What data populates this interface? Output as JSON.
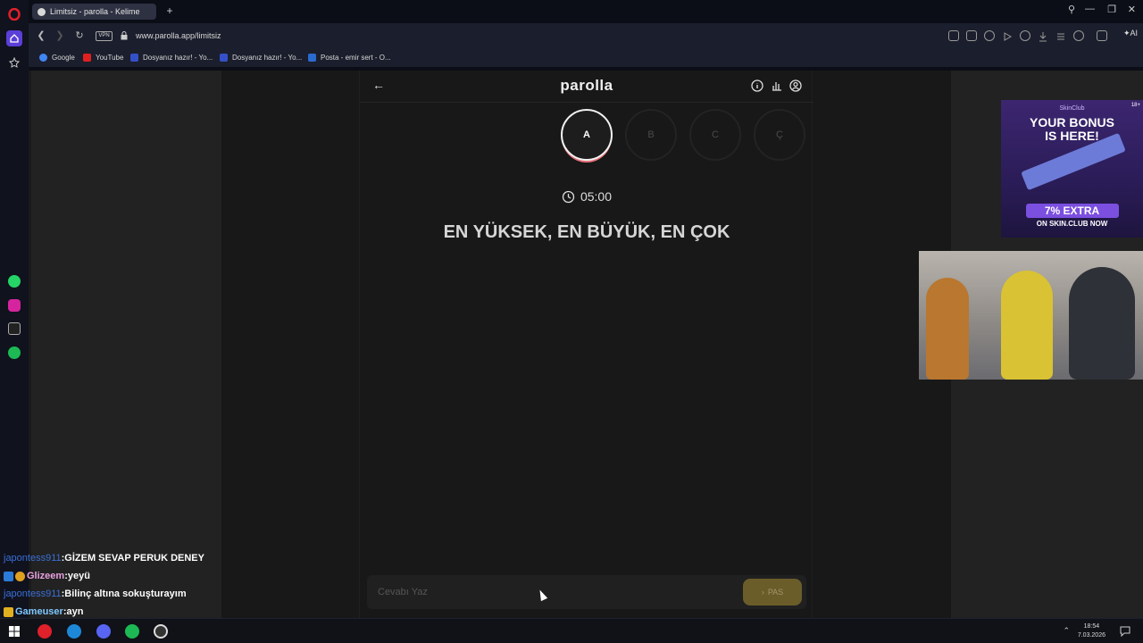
{
  "browser": {
    "tab_title": "Limitsiz - parolla - Kelime",
    "new_tab": "+",
    "vpn": "VPN",
    "url": "www.parolla.app/limitsiz",
    "ai_label": "AI"
  },
  "bookmarks": [
    {
      "label": "Google",
      "color": "#4285f4"
    },
    {
      "label": "YouTube",
      "color": "#e02020"
    },
    {
      "label": "Dosyanız hazır! - Yo...",
      "color": "#3450c8"
    },
    {
      "label": "Dosyanız hazır! - Yo...",
      "color": "#3450c8"
    },
    {
      "label": "Posta - emir sert - O...",
      "color": "#2a6bd1"
    }
  ],
  "game": {
    "logo": "parolla",
    "letters": [
      "A",
      "B",
      "C",
      "Ç"
    ],
    "active_letter": "A",
    "timer": "05:00",
    "clue": "EN YÜKSEK, EN BÜYÜK, EN ÇOK",
    "answer_placeholder": "Cevabı Yaz",
    "pass_label": "PAS"
  },
  "ad": {
    "brand": "SkinClub",
    "age": "18+",
    "line1": "YOUR BONUS",
    "line2": "IS HERE!",
    "promo": "7% EXTRA",
    "site": "ON SKIN.CLUB NOW"
  },
  "chat": [
    {
      "user": "japontess911",
      "text": "GİZEM SEVAP PERUK DENEY"
    },
    {
      "user": "Glizeem",
      "text": "yeyü"
    },
    {
      "user": "japontess911",
      "text": "Bilinç altına sokuşturayım"
    },
    {
      "user": "Gameuser",
      "text": "ayn"
    }
  ],
  "chat_separator": " : ",
  "system": {
    "time": "18:54",
    "date": "7.03.2026"
  },
  "colors": {
    "opera_accent": "#5b3fd8",
    "active_ring": "#f2f2f2",
    "active_underline": "#e8707a",
    "pass_button": "#6b5d2a"
  }
}
